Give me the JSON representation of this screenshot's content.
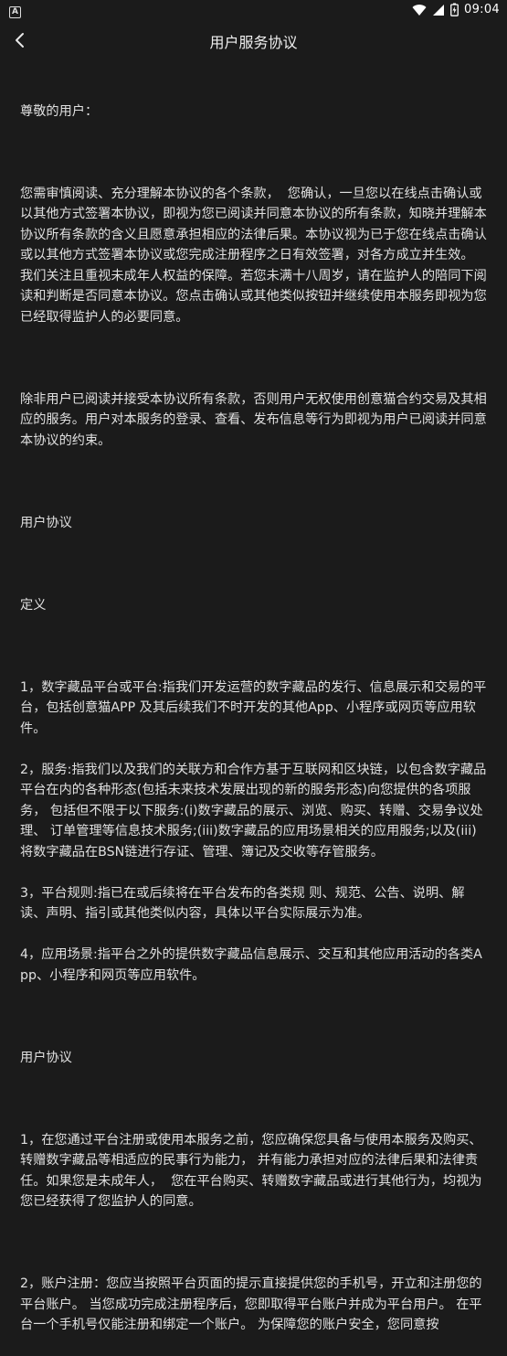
{
  "status_bar": {
    "app_badge": "A",
    "time": "09:04"
  },
  "header": {
    "title": "用户服务协议",
    "back_icon": "chevron-left-icon"
  },
  "content": {
    "greeting": "尊敬的用户：",
    "para_1": "您需审慎阅读、充分理解本协议的各个条款，  您确认，一旦您以在线点击确认或以其他方式签署本协议，即视为您已阅读并同意本协议的所有条款，知晓并理解本协议所有条款的含义且愿意承担相应的法律后果。本协议视为已于您在线点击确认或以其他方式签署本协议或您完成注册程序之日有效签署，对各方成立并生效。  我们关注且重视未成年人权益的保障。若您未满十八周岁，请在监护人的陪同下阅读和判断是否同意本协议。您点击确认或其他类似按钮并继续使用本服务即视为您已经取得监护人的必要同意。",
    "para_2": "除非用户已阅读并接受本协议所有条款，否则用户无权使用创意猫合约交易及其相应的服务。用户对本服务的登录、查看、发布信息等行为即视为用户已阅读并同意本协议的约束。",
    "heading_1": "用户协议",
    "heading_2": "定义",
    "def_1": "1，数字藏品平台或平台:指我们开发运营的数字藏品的发行、信息展示和交易的平台，包括创意猫APP 及其后续我们不时开发的其他App、小程序或网页等应用软件。",
    "def_2": "2，服务:指我们以及我们的关联方和合作方基于互联网和区块链，以包含数字藏品平台在内的各种形态(包括未来技术发展出现的新的服务形态)向您提供的各项服务， 包括但不限于以下服务:(i)数字藏品的展示、浏览、购买、转赠、交易争议处理、 订单管理等信息技术服务;(iii)数字藏品的应用场景相关的应用服务;以及(iii)将数字藏品在BSN链进行存证、管理、簿记及交收等存管服务。",
    "def_3": "3，平台规则:指已在或后续将在平台发布的各类规 则、规范、公告、说明、解读、声明、指引或其他类似内容，具体以平台实际展示为准。",
    "def_4": "4，应用场景:指平台之外的提供数字藏品信息展示、交互和其他应用活动的各类App、小程序和网页等应用软件。",
    "heading_3": "用户协议",
    "rule_1": "1，在您通过平台注册或使用本服务之前，您应确保您具备与使用本服务及购买、转赠数字藏品等相适应的民事行为能力， 并有能力承担对应的法律后果和法律责任。如果您是未成年人，  您在平台购买、转赠数字藏品或进行其他行为，均视为您已经获得了您监护人的同意。",
    "rule_2": "2，账户注册：您应当按照平台页面的提示直接提供您的手机号，开立和注册您的平台账户。 当您成功完成注册程序后，您即取得平台账户并成为平台用户。 在平台一个手机号仅能注册和绑定一个账户。 为保障您的账户安全，您同意按"
  }
}
